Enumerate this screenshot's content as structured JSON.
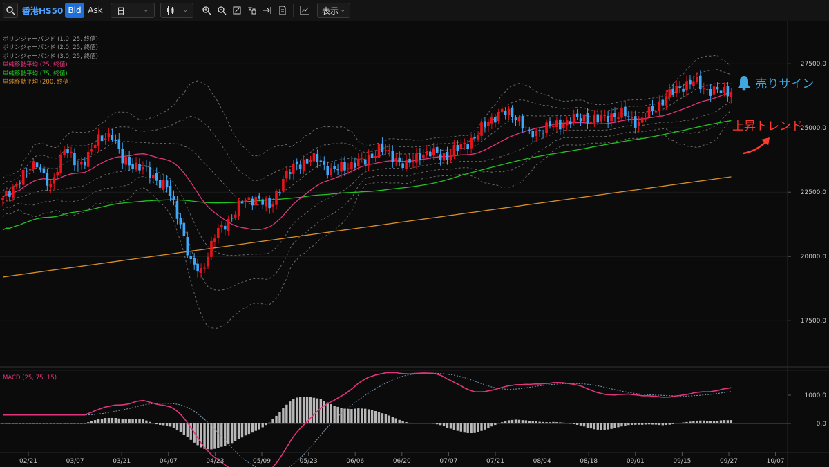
{
  "toolbar": {
    "symbol": "香港HS50",
    "bid": "Bid",
    "ask": "Ask",
    "period": "日",
    "show": "表示"
  },
  "legend": [
    {
      "label": "ボリンジャーバンド (1.0, 25, 終値)",
      "color": "#9a9a9a"
    },
    {
      "label": "ボリンジャーバンド (2.0, 25, 終値)",
      "color": "#9a9a9a"
    },
    {
      "label": "ボリンジャーバンド (3.0, 25, 終値)",
      "color": "#9a9a9a"
    },
    {
      "label": "単純移動平均 (25, 終値)",
      "color": "#e0357a"
    },
    {
      "label": "単純移動平均 (75, 終値)",
      "color": "#22c322"
    },
    {
      "label": "単純移動平均 (200, 終値)",
      "color": "#d9902a"
    }
  ],
  "macd_label": "MACD (25, 75, 15)",
  "annotations": {
    "sell_sign": "売りサイン",
    "uptrend": "上昇トレンド",
    "sell_color": "#3fa7dd",
    "trend_color": "#ff3b30"
  },
  "chart_data": [
    {
      "type": "candlestick",
      "title": "",
      "ylim": [
        16000,
        28500
      ],
      "y_ticks": [
        "27500.0",
        "25000.0",
        "22500.0",
        "20000.0",
        "17500.0"
      ],
      "y_tick_values": [
        27500,
        25000,
        22500,
        20000,
        17500
      ],
      "x_ticks": [
        "02/21",
        "03/07",
        "03/21",
        "04/07",
        "04/23",
        "05/09",
        "05/23",
        "06/06",
        "06/20",
        "07/07",
        "07/21",
        "08/04",
        "08/18",
        "09/01",
        "09/15",
        "09/27",
        "10/07"
      ],
      "up_color": "#e8141b",
      "down_color": "#3fa7f5",
      "close_anchors": [
        [
          0,
          22200
        ],
        [
          5,
          23000
        ],
        [
          10,
          23700
        ],
        [
          14,
          22600
        ],
        [
          18,
          24300
        ],
        [
          22,
          23400
        ],
        [
          27,
          24400
        ],
        [
          32,
          24800
        ],
        [
          35,
          23700
        ],
        [
          40,
          23500
        ],
        [
          44,
          23100
        ],
        [
          48,
          22700
        ],
        [
          52,
          21300
        ],
        [
          55,
          19700
        ],
        [
          58,
          19400
        ],
        [
          62,
          20800
        ],
        [
          66,
          21400
        ],
        [
          70,
          22100
        ],
        [
          74,
          22300
        ],
        [
          78,
          21900
        ],
        [
          82,
          23000
        ],
        [
          86,
          23600
        ],
        [
          92,
          23800
        ],
        [
          96,
          23300
        ],
        [
          102,
          23600
        ],
        [
          106,
          23700
        ],
        [
          110,
          24200
        ],
        [
          114,
          23900
        ],
        [
          118,
          23500
        ],
        [
          122,
          24000
        ],
        [
          126,
          24000
        ],
        [
          130,
          23900
        ],
        [
          134,
          24300
        ],
        [
          138,
          24600
        ],
        [
          142,
          25300
        ],
        [
          146,
          25600
        ],
        [
          150,
          25500
        ],
        [
          154,
          24700
        ],
        [
          158,
          25000
        ],
        [
          162,
          25100
        ],
        [
          166,
          25300
        ],
        [
          170,
          25400
        ],
        [
          174,
          25300
        ],
        [
          178,
          25500
        ],
        [
          182,
          25500
        ],
        [
          186,
          25200
        ],
        [
          190,
          25700
        ],
        [
          194,
          26200
        ],
        [
          198,
          26600
        ],
        [
          202,
          26800
        ],
        [
          206,
          26500
        ],
        [
          210,
          26400
        ],
        [
          213,
          26400
        ]
      ],
      "sma": {
        "25": {
          "start": 22500,
          "end": 25900
        },
        "75": {
          "start": 20000,
          "end": 25000
        },
        "200": {
          "start": 19200,
          "end": 23100
        }
      }
    },
    {
      "type": "bar",
      "title": "MACD (25, 75, 15)",
      "ylim": [
        -500,
        1600
      ],
      "y_ticks": [
        "1000.0",
        "0.0"
      ],
      "y_tick_values": [
        1000,
        0
      ],
      "macd_color": "#e0357a",
      "signal_color": "#7a9ab3",
      "hist_color": "#b8b8b8"
    }
  ]
}
